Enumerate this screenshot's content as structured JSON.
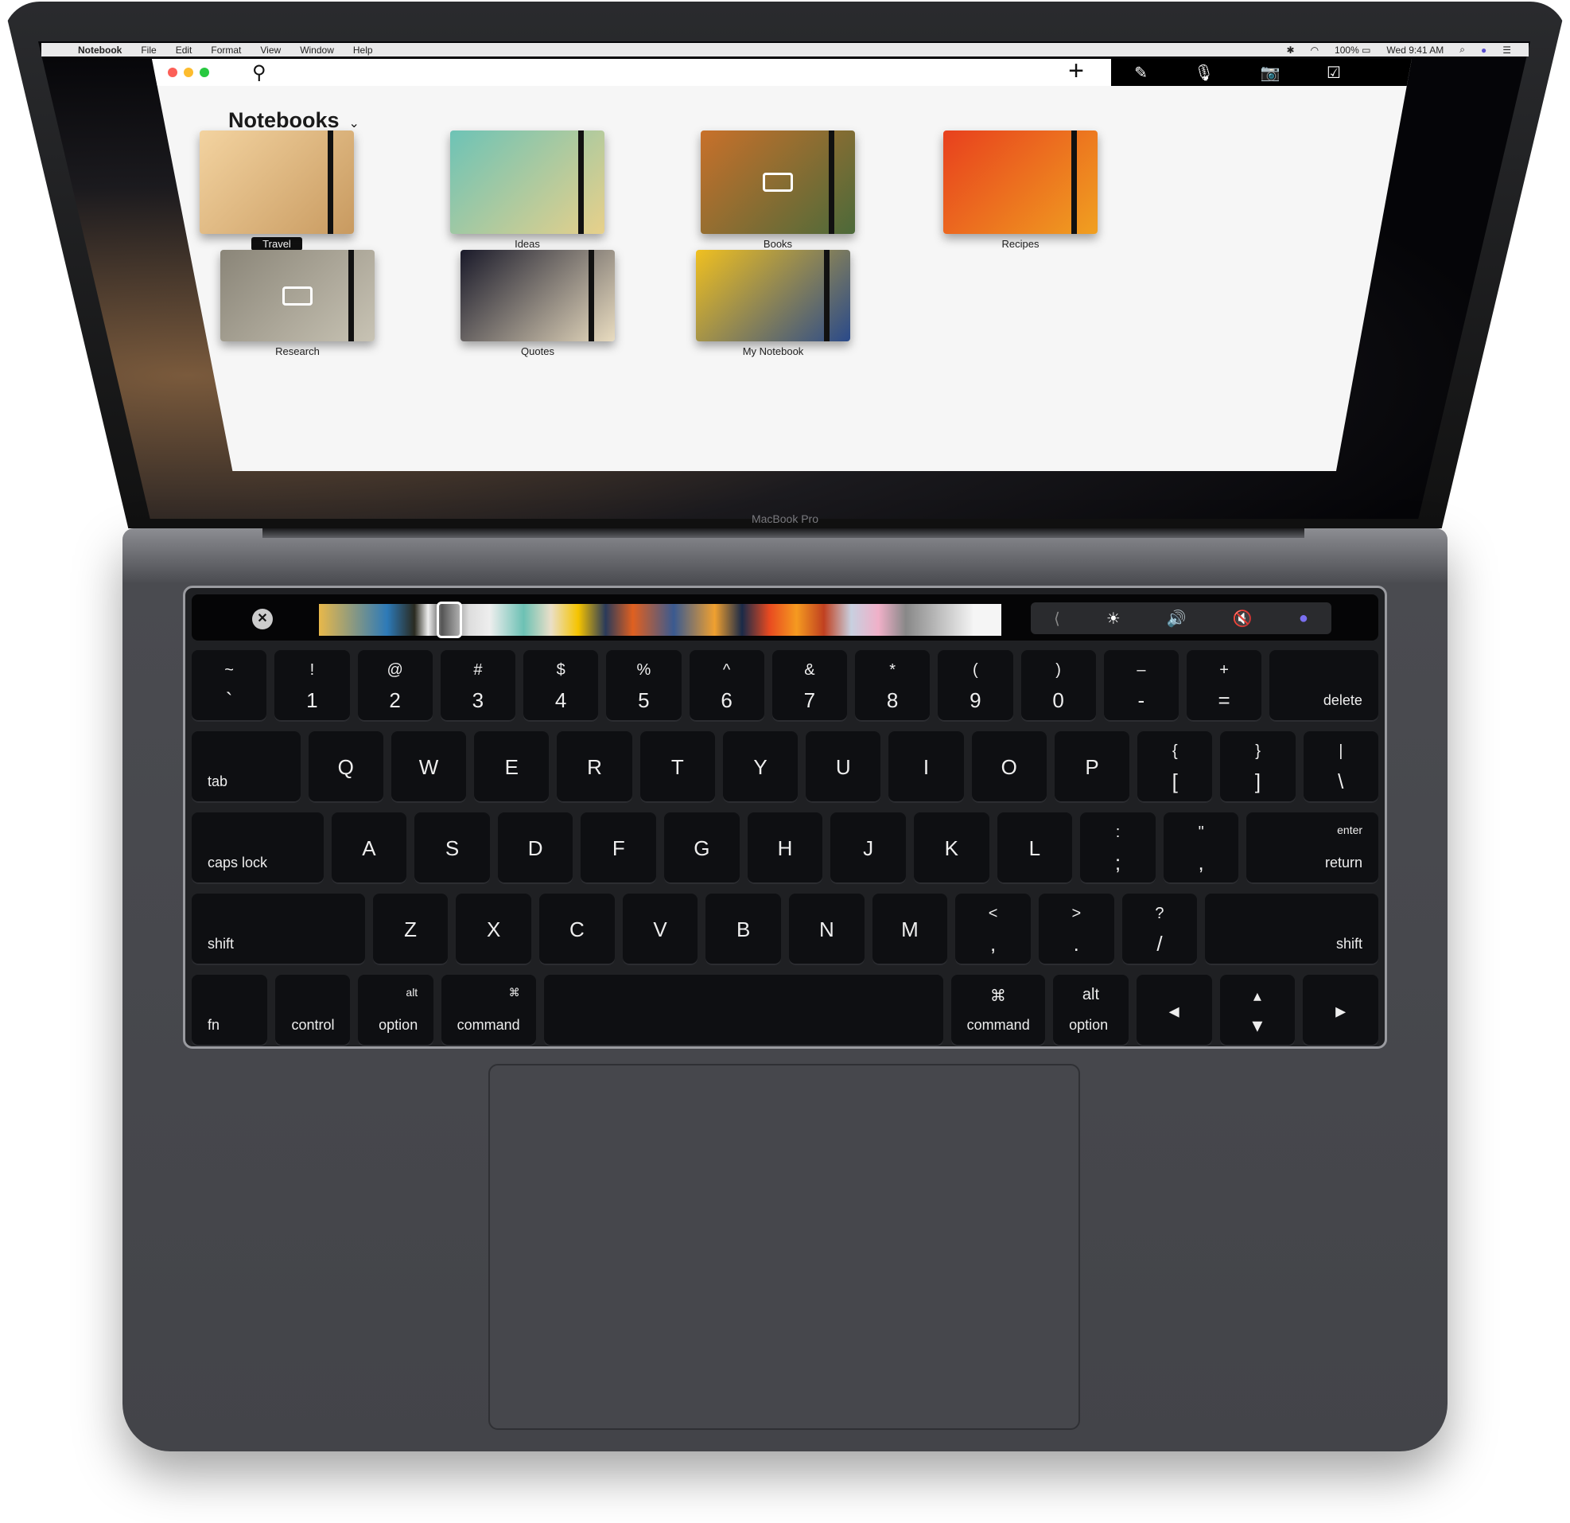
{
  "menubar": {
    "apple": "",
    "app": "Notebook",
    "items": [
      "File",
      "Edit",
      "Format",
      "View",
      "Window",
      "Help"
    ],
    "status": {
      "bluetooth": "✱",
      "wifi": "◠",
      "battery": "100% ▭",
      "clock": "Wed 9:41 AM",
      "spotlight": "⌕",
      "siri": "●",
      "notifications": "☰"
    }
  },
  "window": {
    "search_icon": "⚲",
    "add_label": "+",
    "toolbar": [
      "✎",
      "🎙",
      "📷",
      "☑"
    ]
  },
  "notebooks": {
    "title": "Notebooks",
    "chevron": "⌄",
    "items": [
      {
        "label": "Travel",
        "selected": true,
        "locked": false,
        "colors": [
          "#f3d3a0",
          "#c89a60"
        ]
      },
      {
        "label": "Ideas",
        "selected": false,
        "locked": false,
        "colors": [
          "#6dc3b6",
          "#e8d08a"
        ]
      },
      {
        "label": "Books",
        "selected": false,
        "locked": true,
        "colors": [
          "#c8702a",
          "#4c6a3a"
        ]
      },
      {
        "label": "Recipes",
        "selected": false,
        "locked": false,
        "colors": [
          "#e8401e",
          "#f0a020"
        ]
      },
      {
        "label": "Research",
        "selected": false,
        "locked": true,
        "colors": [
          "#8a8578",
          "#c8c3b4"
        ]
      },
      {
        "label": "Quotes",
        "selected": false,
        "locked": false,
        "colors": [
          "#1a1a2a",
          "#e9dcc0"
        ]
      },
      {
        "label": "My Notebook",
        "selected": false,
        "locked": false,
        "colors": [
          "#f0c020",
          "#2a4a8a"
        ]
      }
    ]
  },
  "brand": "MacBook Pro",
  "touchbar": {
    "close": "✕",
    "controls": [
      "⟨",
      "☀",
      "🔊",
      "🔇",
      "●"
    ]
  },
  "keyboard": {
    "rows": [
      [
        {
          "t": "~",
          "m": "`"
        },
        {
          "t": "!",
          "m": "1"
        },
        {
          "t": "@",
          "m": "2"
        },
        {
          "t": "#",
          "m": "3"
        },
        {
          "t": "$",
          "m": "4"
        },
        {
          "t": "%",
          "m": "5"
        },
        {
          "t": "^",
          "m": "6"
        },
        {
          "t": "&",
          "m": "7"
        },
        {
          "t": "*",
          "m": "8"
        },
        {
          "t": "(",
          "m": "9"
        },
        {
          "t": ")",
          "m": "0"
        },
        {
          "t": "–",
          "m": "-"
        },
        {
          "t": "+",
          "m": "="
        },
        {
          "br": "delete",
          "w": 1.45
        }
      ],
      [
        {
          "bl": "tab",
          "w": 1.45
        },
        {
          "c": "Q"
        },
        {
          "c": "W"
        },
        {
          "c": "E"
        },
        {
          "c": "R"
        },
        {
          "c": "T"
        },
        {
          "c": "Y"
        },
        {
          "c": "U"
        },
        {
          "c": "I"
        },
        {
          "c": "O"
        },
        {
          "c": "P"
        },
        {
          "t": "{",
          "m": "["
        },
        {
          "t": "}",
          "m": "]"
        },
        {
          "t": "|",
          "m": "\\"
        }
      ],
      [
        {
          "bl": "caps lock",
          "w": 1.75
        },
        {
          "c": "A"
        },
        {
          "c": "S"
        },
        {
          "c": "D"
        },
        {
          "c": "F"
        },
        {
          "c": "G"
        },
        {
          "c": "H"
        },
        {
          "c": "J"
        },
        {
          "c": "K"
        },
        {
          "c": "L"
        },
        {
          "t": ":",
          "m": ";"
        },
        {
          "t": "\"",
          "m": ","
        },
        {
          "tr": "enter",
          "br": "return",
          "w": 1.75
        }
      ],
      [
        {
          "bl": "shift",
          "w": 2.3
        },
        {
          "c": "Z"
        },
        {
          "c": "X"
        },
        {
          "c": "C"
        },
        {
          "c": "V"
        },
        {
          "c": "B"
        },
        {
          "c": "N"
        },
        {
          "c": "M"
        },
        {
          "t": "<",
          "m": ","
        },
        {
          "t": ">",
          "m": "."
        },
        {
          "t": "?",
          "m": "/"
        },
        {
          "br": "shift",
          "w": 2.3
        }
      ],
      [
        {
          "bl": "fn"
        },
        {
          "br": "control"
        },
        {
          "tr": "alt",
          "br": "option"
        },
        {
          "tr": "⌘",
          "br": "command",
          "w": 1.25
        },
        {
          "w": 5.3
        },
        {
          "t": "⌘",
          "bl": "command",
          "w": 1.25
        },
        {
          "t": "alt",
          "bl": "option"
        },
        {
          "c": "◂"
        },
        {
          "t": "▴",
          "m": "▾"
        },
        {
          "c": "▸"
        }
      ]
    ]
  }
}
